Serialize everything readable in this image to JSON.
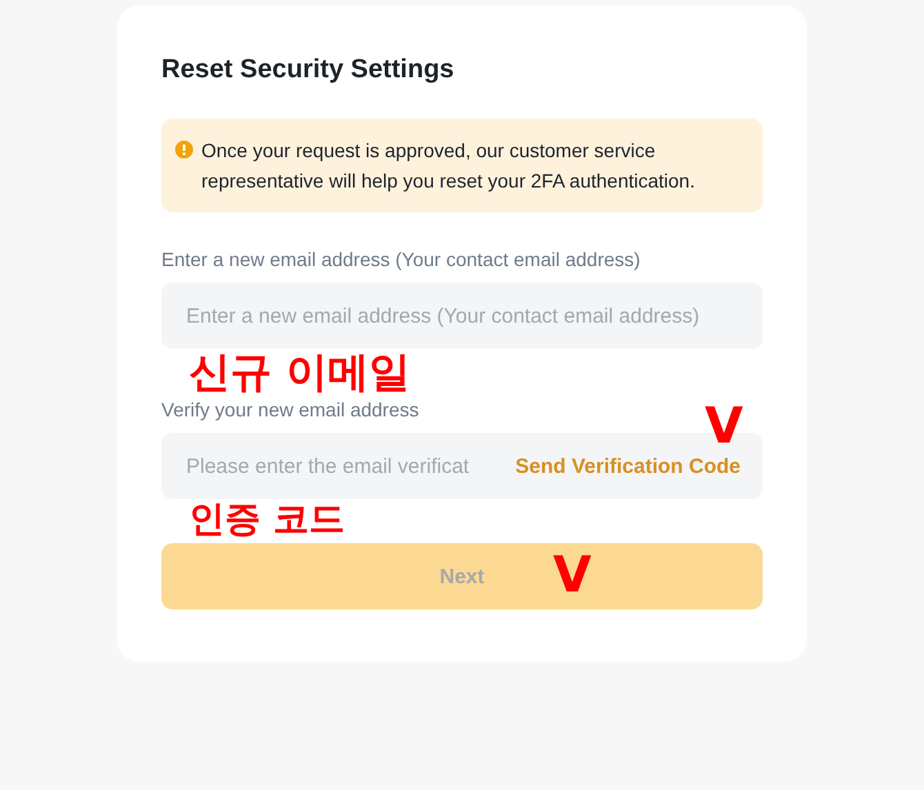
{
  "title": "Reset Security Settings",
  "notice": {
    "text": "Once your request is approved, our customer service representative will help you reset your 2FA authentication."
  },
  "fields": [
    {
      "label": "Enter a new email address (Your contact email address)",
      "placeholder": "Enter a new email address (Your contact email address)",
      "annotation": "신규 이메일"
    },
    {
      "label": "Verify your new email address",
      "placeholder": "Please enter the email verificat",
      "action": "Send Verification Code",
      "annotation": "인증 코드",
      "action_annotation": "V"
    }
  ],
  "next_button": {
    "label": "Next",
    "disabled": true,
    "annotation": "V"
  }
}
